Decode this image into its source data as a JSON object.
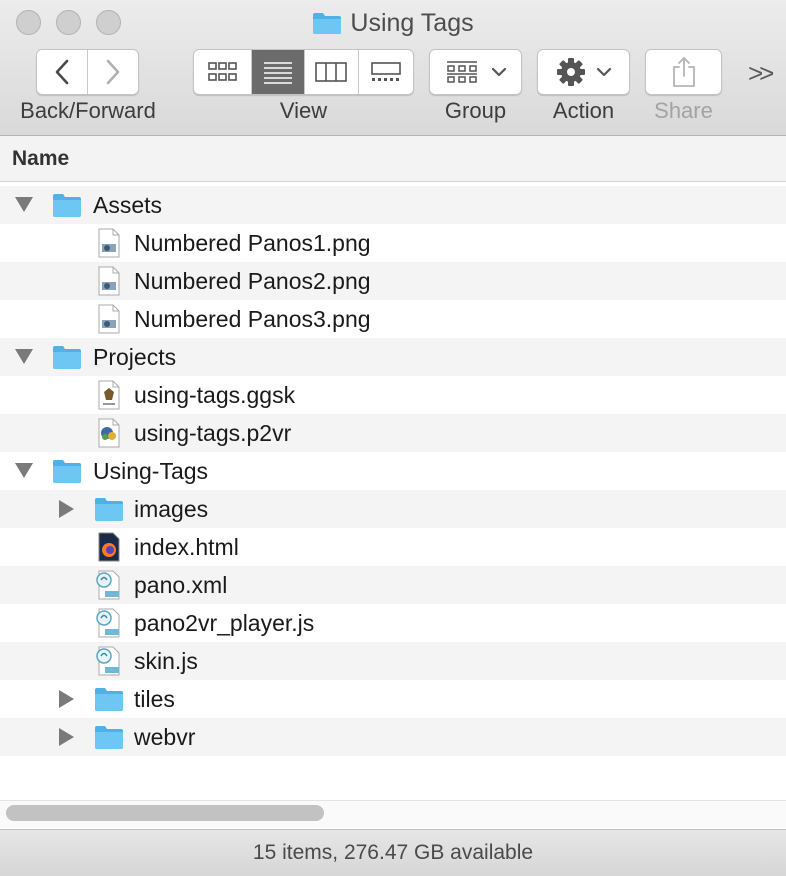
{
  "window": {
    "title": "Using Tags",
    "folder_icon": "folder-icon"
  },
  "toolbar": {
    "back_forward_label": "Back/Forward",
    "view_label": "View",
    "group_label": "Group",
    "action_label": "Action",
    "share_label": "Share",
    "overflow_label": ">>",
    "active_view": "list"
  },
  "columns": {
    "name_header": "Name"
  },
  "files": [
    {
      "name": "Assets",
      "kind": "folder",
      "depth": 0,
      "disclosure": "open"
    },
    {
      "name": "Numbered Panos1.png",
      "kind": "png",
      "depth": 1
    },
    {
      "name": "Numbered Panos2.png",
      "kind": "png",
      "depth": 1
    },
    {
      "name": "Numbered Panos3.png",
      "kind": "png",
      "depth": 1
    },
    {
      "name": "Projects",
      "kind": "folder",
      "depth": 0,
      "disclosure": "open"
    },
    {
      "name": "using-tags.ggsk",
      "kind": "ggsk",
      "depth": 1
    },
    {
      "name": "using-tags.p2vr",
      "kind": "p2vr",
      "depth": 1
    },
    {
      "name": "Using-Tags",
      "kind": "folder",
      "depth": 0,
      "disclosure": "open"
    },
    {
      "name": "images",
      "kind": "folder",
      "depth": 1,
      "disclosure": "closed"
    },
    {
      "name": "index.html",
      "kind": "html",
      "depth": 1
    },
    {
      "name": "pano.xml",
      "kind": "text",
      "depth": 1
    },
    {
      "name": "pano2vr_player.js",
      "kind": "text",
      "depth": 1
    },
    {
      "name": "skin.js",
      "kind": "text",
      "depth": 1
    },
    {
      "name": "tiles",
      "kind": "folder",
      "depth": 1,
      "disclosure": "closed"
    },
    {
      "name": "webvr",
      "kind": "folder",
      "depth": 1,
      "disclosure": "closed"
    }
  ],
  "status": {
    "text": "15 items, 276.47 GB available"
  },
  "colors": {
    "folder": "#6ec6f2",
    "folder_tab": "#4fb1e6",
    "active_segment": "#6b6b6b"
  }
}
